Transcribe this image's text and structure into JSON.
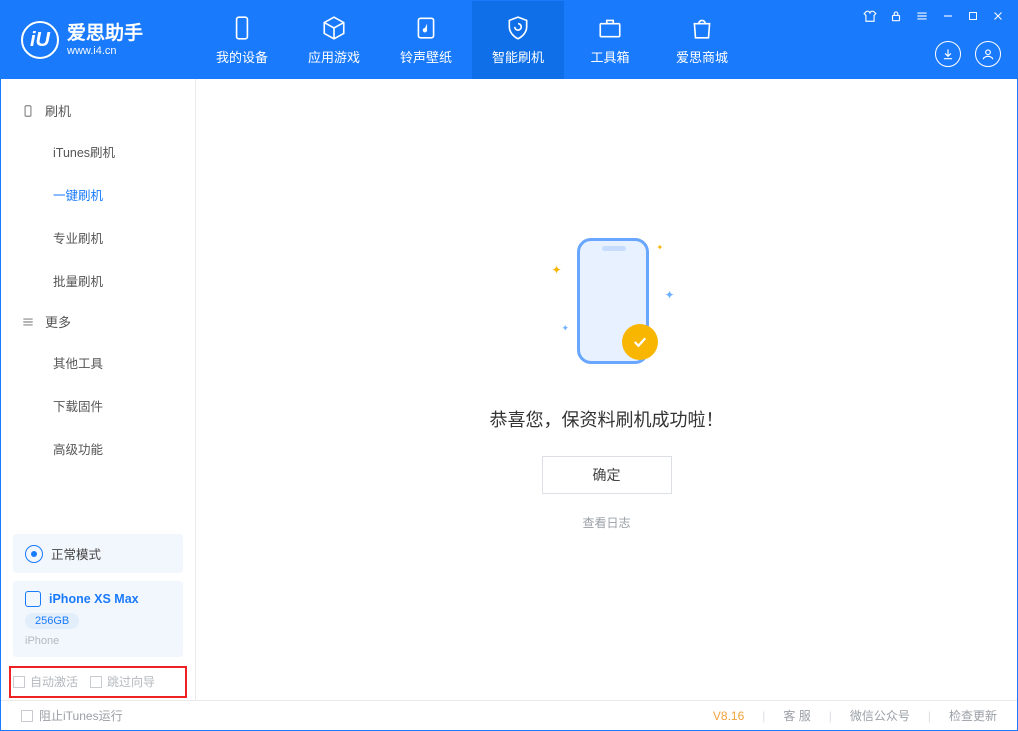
{
  "app": {
    "title": "爱思助手",
    "subtitle": "www.i4.cn"
  },
  "nav": {
    "device": "我的设备",
    "apps": "应用游戏",
    "ringtone": "铃声壁纸",
    "flash": "智能刷机",
    "toolbox": "工具箱",
    "store": "爱思商城"
  },
  "sidebar": {
    "section1": "刷机",
    "items1": [
      "iTunes刷机",
      "一键刷机",
      "专业刷机",
      "批量刷机"
    ],
    "section2": "更多",
    "items2": [
      "其他工具",
      "下载固件",
      "高级功能"
    ]
  },
  "mode": {
    "label": "正常模式"
  },
  "device": {
    "name": "iPhone XS Max",
    "storage": "256GB",
    "type": "iPhone"
  },
  "options": {
    "auto_activate": "自动激活",
    "skip_guide": "跳过向导"
  },
  "main": {
    "success_msg": "恭喜您，保资料刷机成功啦！",
    "confirm": "确定",
    "view_log": "查看日志"
  },
  "footer": {
    "block_itunes": "阻止iTunes运行",
    "version": "V8.16",
    "support": "客 服",
    "wechat": "微信公众号",
    "update": "检查更新"
  }
}
